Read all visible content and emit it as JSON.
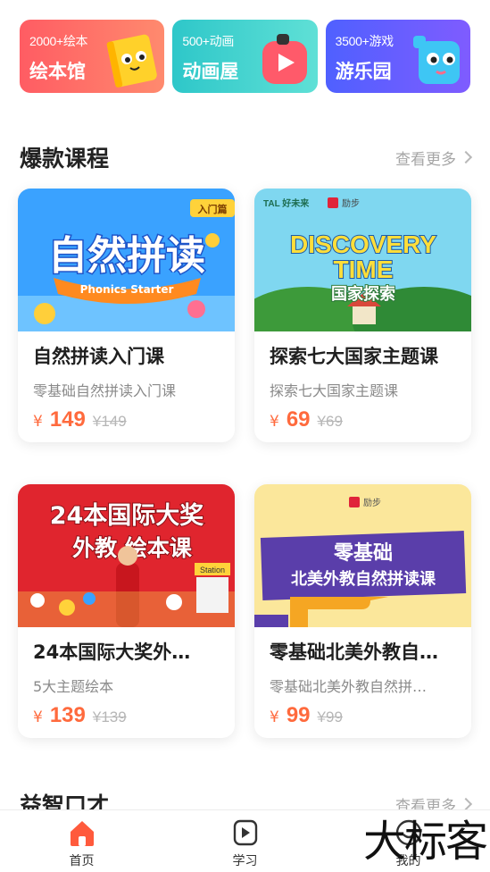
{
  "categories": [
    {
      "count": "2000+绘本",
      "name": "绘本馆",
      "art_icon": "book-mascot-icon",
      "color": "#ff6a66"
    },
    {
      "count": "500+动画",
      "name": "动画屋",
      "art_icon": "play-mascot-icon",
      "color": "#3ccfcd"
    },
    {
      "count": "3500+游戏",
      "name": "游乐园",
      "art_icon": "game-mascot-icon",
      "color": "#5b5cff"
    }
  ],
  "hot_section": {
    "title": "爆款课程",
    "more": "查看更多"
  },
  "courses": [
    {
      "thumb_title": "自然拼读",
      "thumb_banner": "Phonics Starter",
      "thumb_tag": "入门篇",
      "title": "自然拼读入门课",
      "subtitle": "零基础自然拼读入门课",
      "currency": "¥",
      "price": "149",
      "original": "¥149"
    },
    {
      "thumb_brand": "TAL 好未来",
      "thumb_brand2": "励步",
      "thumb_line1": "DISCOVERY",
      "thumb_line2": "TIME",
      "thumb_sub": "国家探索",
      "title": "探索七大国家主题课",
      "subtitle": "探索七大国家主题课",
      "currency": "¥",
      "price": "69",
      "original": "¥69"
    },
    {
      "thumb_line1": "24本国际大奖",
      "thumb_line2": "外教 绘本课",
      "thumb_sign": "Station",
      "title": "24本国际大奖外…",
      "subtitle": "5大主题绘本",
      "currency": "¥",
      "price": "139",
      "original": "¥139"
    },
    {
      "thumb_brand2": "励步",
      "thumb_line1": "零基础",
      "thumb_line2": "北美外教自然拼读课",
      "title": "零基础北美外教自…",
      "subtitle": "零基础北美外教自然拼…",
      "currency": "¥",
      "price": "99",
      "original": "¥99"
    }
  ],
  "next_section": {
    "title": "益智口才",
    "more": "查看更多"
  },
  "tabbar": [
    {
      "label": "首页",
      "icon": "home-icon",
      "active": true
    },
    {
      "label": "学习",
      "icon": "play-icon",
      "active": false
    },
    {
      "label": "我的",
      "icon": "profile-icon",
      "active": false
    }
  ],
  "watermark": "大标客",
  "colors": {
    "price": "#ff6a3d",
    "home_active": "#ff5a3c"
  }
}
